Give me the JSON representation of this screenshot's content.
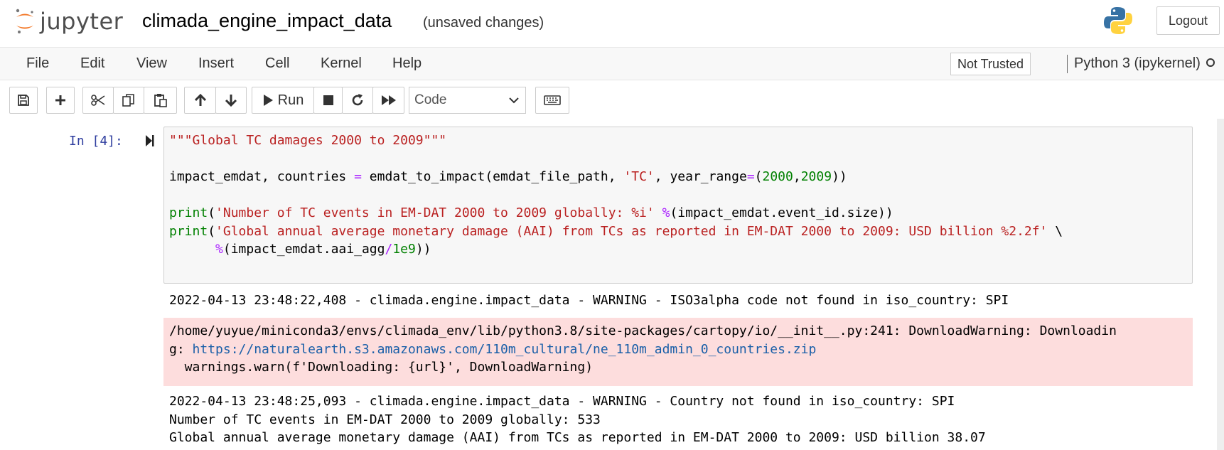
{
  "header": {
    "logo_text": "jupyter",
    "notebook_title": "climada_engine_impact_data",
    "save_status": "(unsaved changes)",
    "logout_label": "Logout"
  },
  "menubar": {
    "items": [
      "File",
      "Edit",
      "View",
      "Insert",
      "Cell",
      "Kernel",
      "Help"
    ],
    "trust_label": "Not Trusted",
    "kernel_name": "Python 3 (ipykernel)"
  },
  "toolbar": {
    "run_label": "Run",
    "cell_type": "Code"
  },
  "cell": {
    "prompt": "In [4]:",
    "code_lines": [
      "\"\"\"Global TC damages 2000 to 2009\"\"\"",
      "",
      "impact_emdat, countries = emdat_to_impact(emdat_file_path, 'TC', year_range=(2000,2009))",
      "",
      "print('Number of TC events in EM-DAT 2000 to 2009 globally: %i' %(impact_emdat.event_id.size))",
      "print('Global annual average monetary damage (AAI) from TCs as reported in EM-DAT 2000 to 2009: USD billion %2.2f' \\",
      "      %(impact_emdat.aai_agg/1e9))"
    ],
    "outputs": {
      "log_1": "2022-04-13 23:48:22,408 - climada.engine.impact_data - WARNING - ISO3alpha code not found in iso_country: SPI",
      "stderr_line_1": "/home/yuyue/miniconda3/envs/climada_env/lib/python3.8/site-packages/cartopy/io/__init__.py:241: DownloadWarning: Downloadin",
      "stderr_line_2_prefix": "g: ",
      "stderr_url": "https://naturalearth.s3.amazonaws.com/110m_cultural/ne_110m_admin_0_countries.zip",
      "stderr_line_3": "  warnings.warn(f'Downloading: {url}', DownloadWarning)",
      "log_2": "2022-04-13 23:48:25,093 - climada.engine.impact_data - WARNING - Country not found in iso_country: SPI",
      "result_1": "Number of TC events in EM-DAT 2000 to 2009 globally: 533",
      "result_2": "Global annual average monetary damage (AAI) from TCs as reported in EM-DAT 2000 to 2009: USD billion 38.07"
    }
  },
  "icons": {
    "logo": "jupyter-logo-icon",
    "python": "python-logo-icon",
    "kernel_status": "kernel-idle-indicator-icon"
  },
  "colors": {
    "prompt": "#303f9f",
    "string": "#ba2121",
    "builtin": "#008000",
    "operator": "#aa22ff",
    "stderr_bg": "#fddddd",
    "link": "#1a5fa8"
  }
}
